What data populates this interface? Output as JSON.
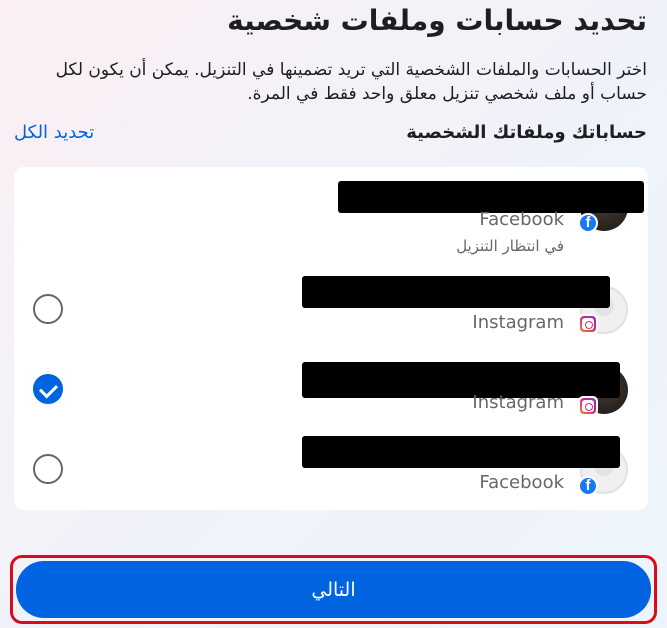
{
  "header": {
    "title": "تحديد حسابات وملفات شخصية",
    "description": "اختر الحسابات والملفات الشخصية التي تريد تضمينها في التنزيل. يمكن أن يكون لكل حساب أو ملف شخصي تنزيل معلق واحد فقط في المرة."
  },
  "section": {
    "title": "حساباتك وملفاتك الشخصية",
    "select_all": "تحديد الكل"
  },
  "accounts": [
    {
      "platform": "Facebook",
      "platform_icon": "facebook-icon",
      "status": "في انتظار التنزيل",
      "selected": null
    },
    {
      "platform": "Instagram",
      "platform_icon": "instagram-icon",
      "status": "",
      "selected": false
    },
    {
      "platform": "Instagram",
      "platform_icon": "instagram-icon",
      "status": "",
      "selected": true
    },
    {
      "platform": "Facebook",
      "platform_icon": "facebook-icon",
      "status": "",
      "selected": false
    }
  ],
  "footer": {
    "next_label": "التالي"
  },
  "colors": {
    "accent": "#0064e0",
    "highlight_border": "#d70d1a",
    "secondary_text": "#65676b"
  }
}
